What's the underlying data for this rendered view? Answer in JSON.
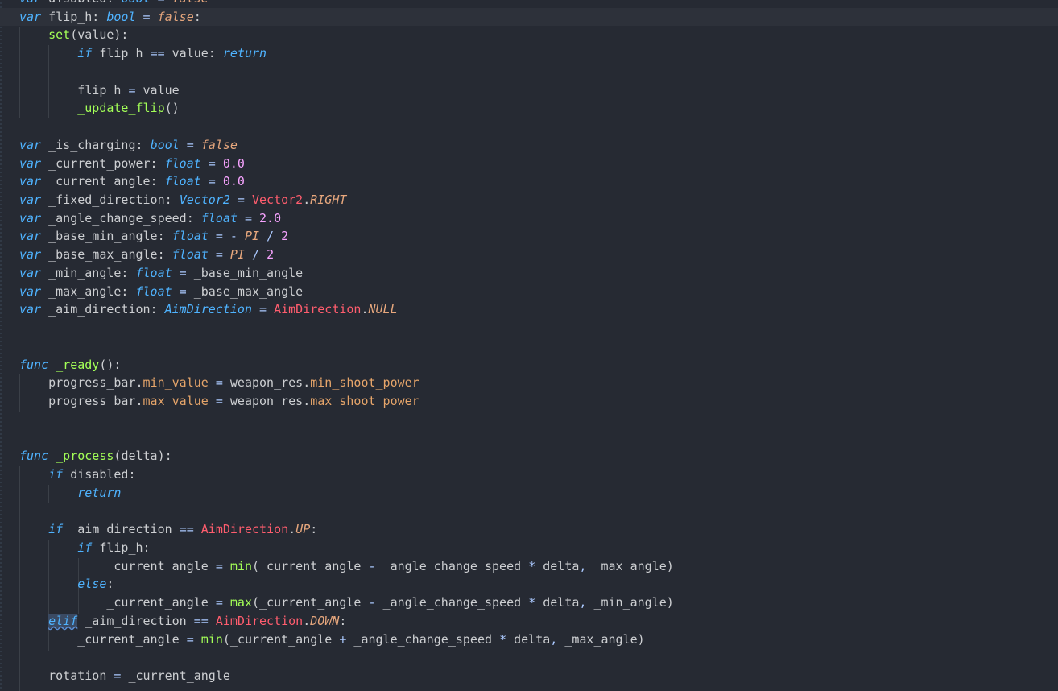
{
  "editor": {
    "lines": [
      [
        [
          "kwi",
          "var"
        ],
        [
          "def",
          " disabled: "
        ],
        [
          "typei",
          "bool"
        ],
        [
          "op",
          " = "
        ],
        [
          "const",
          "false"
        ]
      ],
      [
        [
          "kwi",
          "var"
        ],
        [
          "def",
          " flip_h: "
        ],
        [
          "typei",
          "bool"
        ],
        [
          "op",
          " = "
        ],
        [
          "const",
          "false"
        ],
        [
          "def",
          ":"
        ]
      ],
      [
        [
          "def",
          "    "
        ],
        [
          "setter",
          "set"
        ],
        [
          "paren",
          "("
        ],
        [
          "def",
          "value"
        ],
        [
          "paren",
          "):"
        ]
      ],
      [
        [
          "def",
          "        "
        ],
        [
          "kwi",
          "if"
        ],
        [
          "def",
          " flip_h "
        ],
        [
          "op",
          "=="
        ],
        [
          "def",
          " value: "
        ],
        [
          "kwi",
          "return"
        ]
      ],
      [
        [
          "def",
          ""
        ]
      ],
      [
        [
          "def",
          "        flip_h "
        ],
        [
          "op",
          "="
        ],
        [
          "def",
          " value"
        ]
      ],
      [
        [
          "def",
          "        "
        ],
        [
          "ufn",
          "_update_flip"
        ],
        [
          "paren",
          "()"
        ]
      ],
      [
        [
          "def",
          ""
        ]
      ],
      [
        [
          "kwi",
          "var"
        ],
        [
          "def",
          " _is_charging: "
        ],
        [
          "typei",
          "bool"
        ],
        [
          "op",
          " = "
        ],
        [
          "const",
          "false"
        ]
      ],
      [
        [
          "kwi",
          "var"
        ],
        [
          "def",
          " _current_power: "
        ],
        [
          "typei",
          "float"
        ],
        [
          "op",
          " = "
        ],
        [
          "num",
          "0.0"
        ]
      ],
      [
        [
          "kwi",
          "var"
        ],
        [
          "def",
          " _current_angle: "
        ],
        [
          "typei",
          "float"
        ],
        [
          "op",
          " = "
        ],
        [
          "num",
          "0.0"
        ]
      ],
      [
        [
          "kwi",
          "var"
        ],
        [
          "def",
          " _fixed_direction: "
        ],
        [
          "typei",
          "Vector2"
        ],
        [
          "op",
          " = "
        ],
        [
          "cls",
          "Vector2"
        ],
        [
          "def",
          "."
        ],
        [
          "const",
          "RIGHT"
        ]
      ],
      [
        [
          "kwi",
          "var"
        ],
        [
          "def",
          " _angle_change_speed: "
        ],
        [
          "typei",
          "float"
        ],
        [
          "op",
          " = "
        ],
        [
          "num",
          "2.0"
        ]
      ],
      [
        [
          "kwi",
          "var"
        ],
        [
          "def",
          " _base_min_angle: "
        ],
        [
          "typei",
          "float"
        ],
        [
          "op",
          " = - "
        ],
        [
          "const",
          "PI"
        ],
        [
          "op",
          " / "
        ],
        [
          "num",
          "2"
        ]
      ],
      [
        [
          "kwi",
          "var"
        ],
        [
          "def",
          " _base_max_angle: "
        ],
        [
          "typei",
          "float"
        ],
        [
          "op",
          " = "
        ],
        [
          "const",
          "PI"
        ],
        [
          "op",
          " / "
        ],
        [
          "num",
          "2"
        ]
      ],
      [
        [
          "kwi",
          "var"
        ],
        [
          "def",
          " _min_angle: "
        ],
        [
          "typei",
          "float"
        ],
        [
          "op",
          " = "
        ],
        [
          "def",
          "_base_min_angle"
        ]
      ],
      [
        [
          "kwi",
          "var"
        ],
        [
          "def",
          " _max_angle: "
        ],
        [
          "typei",
          "float"
        ],
        [
          "op",
          " = "
        ],
        [
          "def",
          "_base_max_angle"
        ]
      ],
      [
        [
          "kwi",
          "var"
        ],
        [
          "def",
          " _aim_direction: "
        ],
        [
          "typei",
          "AimDirection"
        ],
        [
          "op",
          " = "
        ],
        [
          "cls",
          "AimDirection"
        ],
        [
          "def",
          "."
        ],
        [
          "const",
          "NULL"
        ]
      ],
      [
        [
          "def",
          ""
        ]
      ],
      [
        [
          "def",
          ""
        ]
      ],
      [
        [
          "kwi",
          "func"
        ],
        [
          "def",
          " "
        ],
        [
          "ufn",
          "_ready"
        ],
        [
          "paren",
          "():"
        ]
      ],
      [
        [
          "def",
          "    progress_bar."
        ],
        [
          "prop",
          "min_value"
        ],
        [
          "op",
          " = "
        ],
        [
          "def",
          "weapon_res."
        ],
        [
          "prop",
          "min_shoot_power"
        ]
      ],
      [
        [
          "def",
          "    progress_bar."
        ],
        [
          "prop",
          "max_value"
        ],
        [
          "op",
          " = "
        ],
        [
          "def",
          "weapon_res."
        ],
        [
          "prop",
          "max_shoot_power"
        ]
      ],
      [
        [
          "def",
          ""
        ]
      ],
      [
        [
          "def",
          ""
        ]
      ],
      [
        [
          "kwi",
          "func"
        ],
        [
          "def",
          " "
        ],
        [
          "ufn",
          "_process"
        ],
        [
          "paren",
          "("
        ],
        [
          "def",
          "delta"
        ],
        [
          "paren",
          "):"
        ]
      ],
      [
        [
          "def",
          "    "
        ],
        [
          "kwi",
          "if"
        ],
        [
          "def",
          " disabled:"
        ]
      ],
      [
        [
          "def",
          "        "
        ],
        [
          "kwi",
          "return"
        ]
      ],
      [
        [
          "def",
          ""
        ]
      ],
      [
        [
          "def",
          "    "
        ],
        [
          "kwi",
          "if"
        ],
        [
          "def",
          " _aim_direction "
        ],
        [
          "op",
          "=="
        ],
        [
          "def",
          " "
        ],
        [
          "cls",
          "AimDirection"
        ],
        [
          "def",
          "."
        ],
        [
          "const",
          "UP"
        ],
        [
          "def",
          ":"
        ]
      ],
      [
        [
          "def",
          "        "
        ],
        [
          "kwi",
          "if"
        ],
        [
          "def",
          " flip_h:"
        ]
      ],
      [
        [
          "def",
          "            _current_angle "
        ],
        [
          "op",
          "="
        ],
        [
          "def",
          " "
        ],
        [
          "builtin",
          "min"
        ],
        [
          "paren",
          "("
        ],
        [
          "def",
          "_current_angle "
        ],
        [
          "op",
          "-"
        ],
        [
          "def",
          " _angle_change_speed "
        ],
        [
          "op",
          "*"
        ],
        [
          "def",
          " delta"
        ],
        [
          "op",
          ","
        ],
        [
          "def",
          " _max_angle"
        ],
        [
          "paren",
          ")"
        ]
      ],
      [
        [
          "def",
          "        "
        ],
        [
          "kwi",
          "else"
        ],
        [
          "def",
          ":"
        ]
      ],
      [
        [
          "def",
          "            _current_angle "
        ],
        [
          "op",
          "="
        ],
        [
          "def",
          " "
        ],
        [
          "builtin",
          "max"
        ],
        [
          "paren",
          "("
        ],
        [
          "def",
          "_current_angle "
        ],
        [
          "op",
          "-"
        ],
        [
          "def",
          " _angle_change_speed "
        ],
        [
          "op",
          "*"
        ],
        [
          "def",
          " delta"
        ],
        [
          "op",
          ","
        ],
        [
          "def",
          " _min_angle"
        ],
        [
          "paren",
          ")"
        ]
      ],
      [
        [
          "def",
          "    "
        ],
        [
          "sel",
          "elif"
        ],
        [
          "def",
          " _aim_direction "
        ],
        [
          "op",
          "=="
        ],
        [
          "def",
          " "
        ],
        [
          "cls",
          "AimDirection"
        ],
        [
          "def",
          "."
        ],
        [
          "const",
          "DOWN"
        ],
        [
          "def",
          ":"
        ]
      ],
      [
        [
          "def",
          "        _current_angle "
        ],
        [
          "op",
          "="
        ],
        [
          "def",
          " "
        ],
        [
          "builtin",
          "min"
        ],
        [
          "paren",
          "("
        ],
        [
          "def",
          "_current_angle "
        ],
        [
          "op",
          "+"
        ],
        [
          "def",
          " _angle_change_speed "
        ],
        [
          "op",
          "*"
        ],
        [
          "def",
          " delta"
        ],
        [
          "op",
          ","
        ],
        [
          "def",
          " _max_angle"
        ],
        [
          "paren",
          ")"
        ]
      ],
      [
        [
          "def",
          ""
        ]
      ],
      [
        [
          "def",
          "    rotation "
        ],
        [
          "op",
          "="
        ],
        [
          "def",
          " _current_angle"
        ]
      ]
    ]
  }
}
